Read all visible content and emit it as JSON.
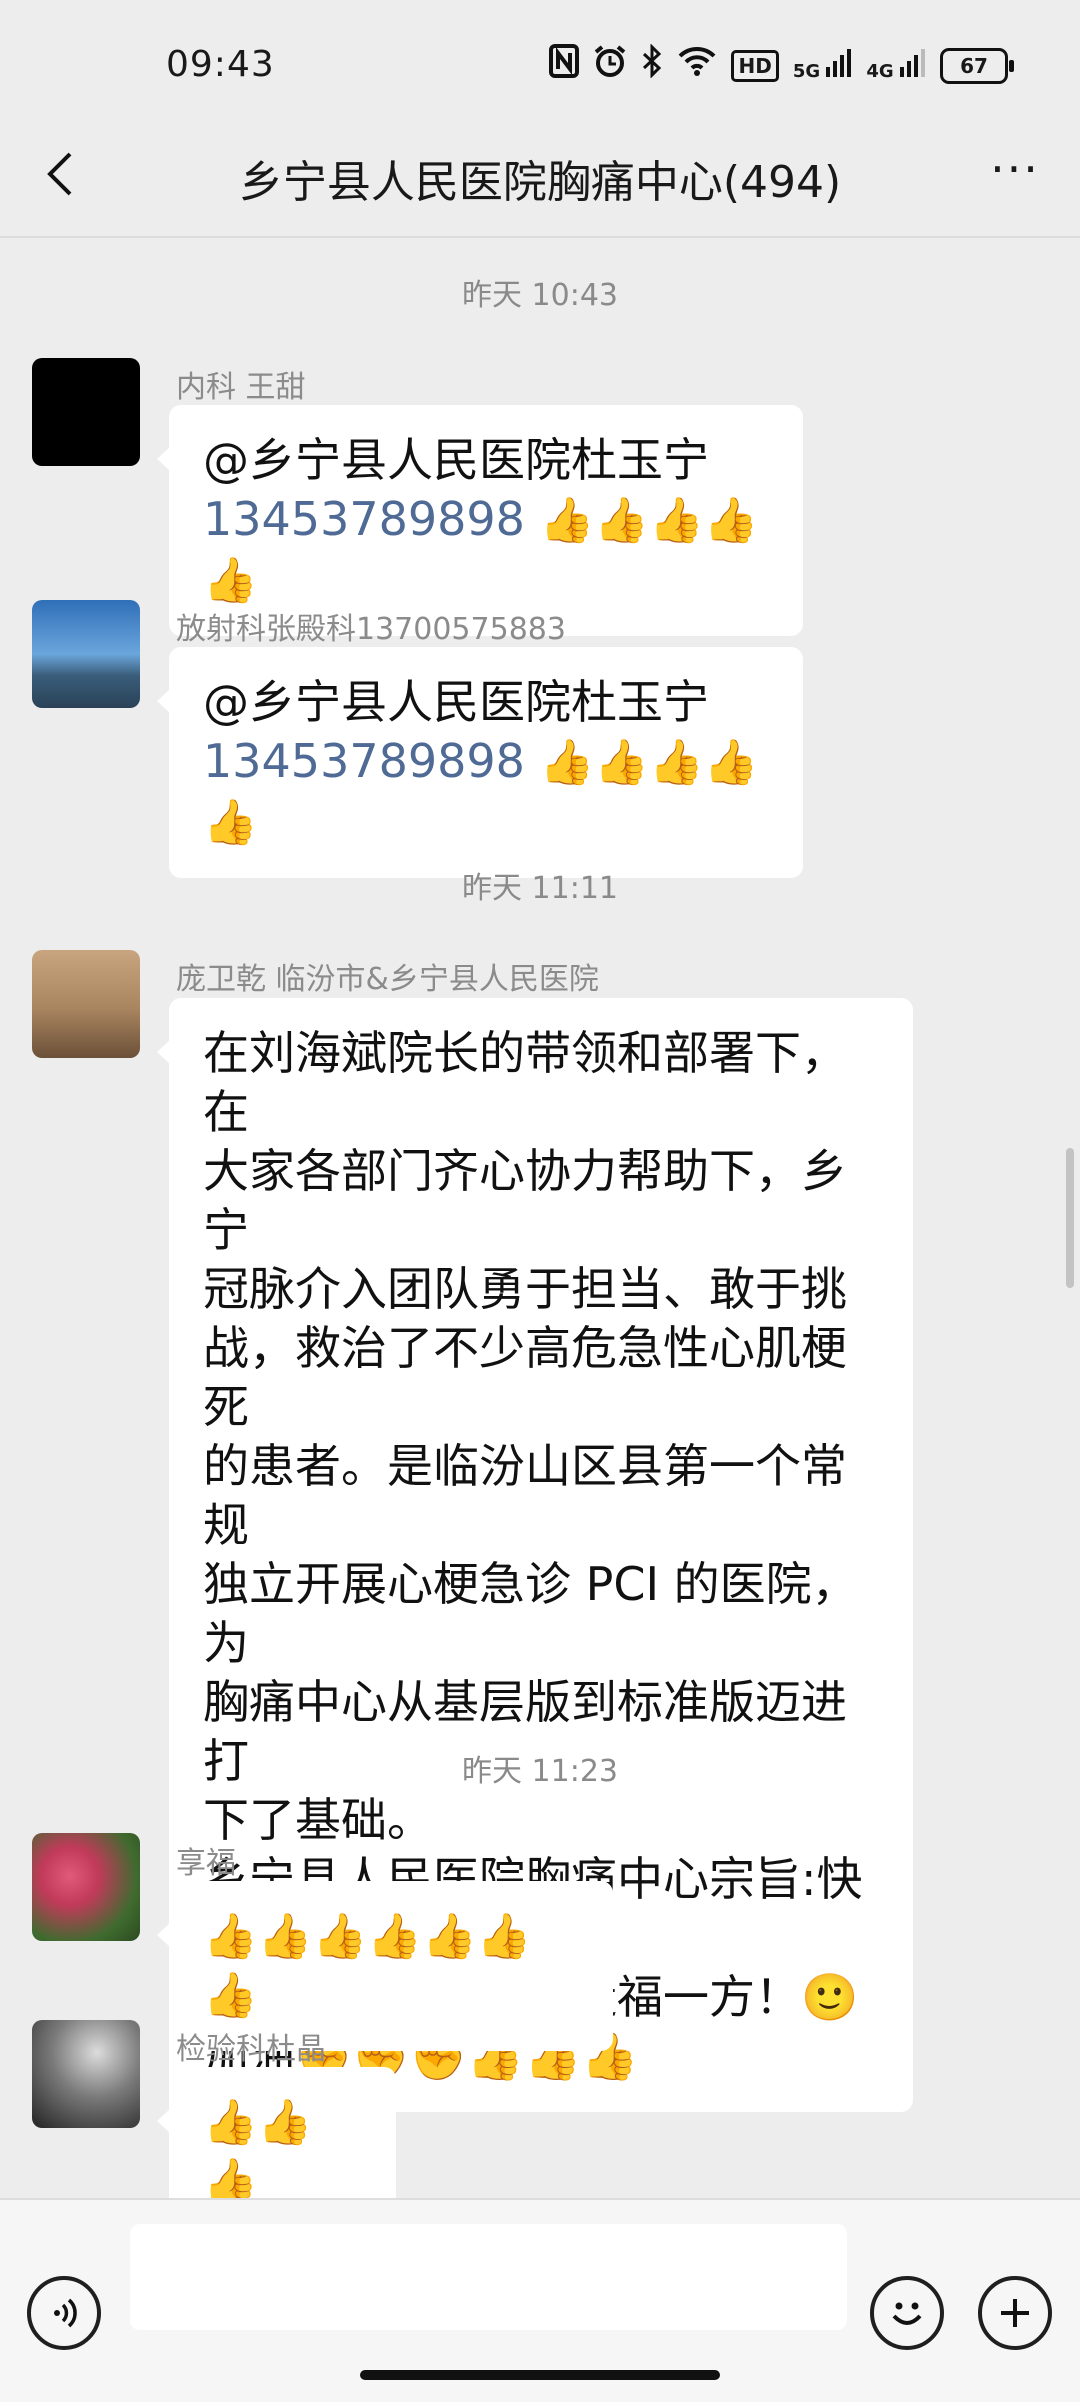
{
  "status_bar": {
    "time": "09:43",
    "battery": "67",
    "icons": [
      "nfc-icon",
      "alarm-icon",
      "bluetooth-icon",
      "wifi-icon",
      "hd-icon",
      "5g-signal-icon",
      "4g-signal-icon"
    ],
    "hd_label": "HD",
    "sig5": "5G",
    "sig4": "4G"
  },
  "header": {
    "title": "乡宁县人民医院胸痛中心(494)",
    "more_label": "···"
  },
  "messages": [
    {
      "timestamp": "昨天 10:43"
    },
    {
      "sender": "内科 王甜",
      "lines": [
        "@乡宁县人民医院杜玉宁",
        "13453789898"
      ],
      "emoji_tail": "👍👍👍👍👍"
    },
    {
      "sender": "放射科张殿科13700575883",
      "lines": [
        "@乡宁县人民医院杜玉宁",
        "13453789898"
      ],
      "emoji_tail": "👍👍👍👍👍"
    },
    {
      "timestamp": "昨天 11:11"
    },
    {
      "sender": "庞卫乾 临汾市&乡宁县人民医院",
      "lines": [
        "在刘海斌院长的带领和部署下，在",
        "大家各部门齐心协力帮助下，乡宁",
        "冠脉介入团队勇于担当、敢于挑",
        "战，救治了不少高危急性心肌梗死",
        "的患者。是临汾山区县第一个常规",
        "独立开展心梗急诊 PCI 的医院，为",
        "胸痛中心从基层版到标准版迈进打",
        "下了基础。",
        "乡宁县人民医院胸痛中心宗旨:快速",
        "反应、高效救治、造福一方！🙂",
        "加油✊✊✊👍👍👍"
      ]
    },
    {
      "timestamp": "昨天 11:23"
    },
    {
      "sender": "享福",
      "lines": [
        "👍👍👍👍👍👍👍"
      ]
    },
    {
      "sender": "检验科杜晶",
      "lines": [
        "👍👍👍"
      ]
    }
  ],
  "input_bar": {
    "voice_icon": "voice-icon",
    "emoji_icon": "emoji-face-icon",
    "plus_icon": "plus-icon",
    "value": ""
  }
}
